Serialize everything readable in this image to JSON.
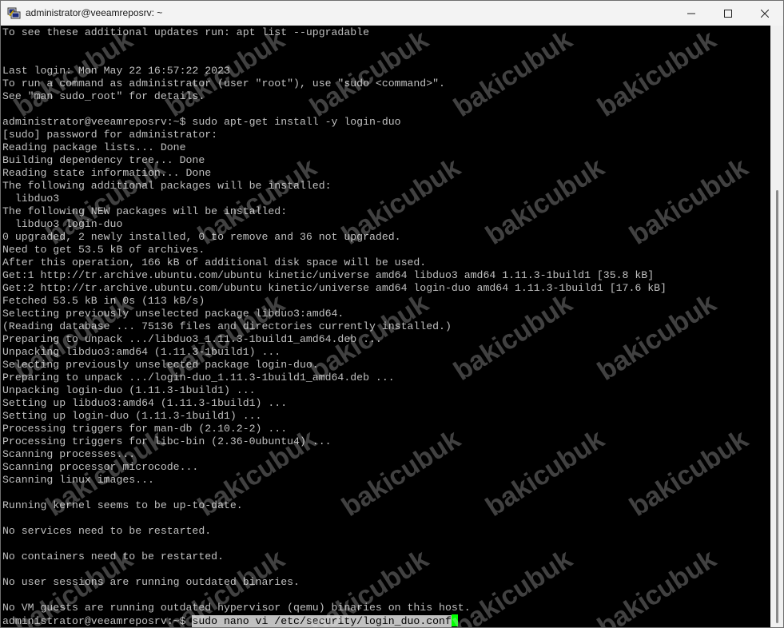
{
  "window": {
    "title": "administrator@veeamreposrv: ~",
    "icon": "putty-icon",
    "controls": {
      "minimize": "minimize-icon",
      "maximize": "maximize-icon",
      "close": "close-icon"
    }
  },
  "terminal": {
    "lines": [
      "To see these additional updates run: apt list --upgradable",
      "",
      "",
      "Last login: Mon May 22 16:57:22 2023",
      "To run a command as administrator (user \"root\"), use \"sudo <command>\".",
      "See \"man sudo_root\" for details.",
      "",
      "administrator@veeamreposrv:~$ sudo apt-get install -y login-duo",
      "[sudo] password for administrator:",
      "Reading package lists... Done",
      "Building dependency tree... Done",
      "Reading state information... Done",
      "The following additional packages will be installed:",
      "  libduo3",
      "The following NEW packages will be installed:",
      "  libduo3 login-duo",
      "0 upgraded, 2 newly installed, 0 to remove and 36 not upgraded.",
      "Need to get 53.5 kB of archives.",
      "After this operation, 166 kB of additional disk space will be used.",
      "Get:1 http://tr.archive.ubuntu.com/ubuntu kinetic/universe amd64 libduo3 amd64 1.11.3-1build1 [35.8 kB]",
      "Get:2 http://tr.archive.ubuntu.com/ubuntu kinetic/universe amd64 login-duo amd64 1.11.3-1build1 [17.6 kB]",
      "Fetched 53.5 kB in 0s (113 kB/s)",
      "Selecting previously unselected package libduo3:amd64.",
      "(Reading database ... 75136 files and directories currently installed.)",
      "Preparing to unpack .../libduo3_1.11.3-1build1_amd64.deb ...",
      "Unpacking libduo3:amd64 (1.11.3-1build1) ...",
      "Selecting previously unselected package login-duo.",
      "Preparing to unpack .../login-duo_1.11.3-1build1_amd64.deb ...",
      "Unpacking login-duo (1.11.3-1build1) ...",
      "Setting up libduo3:amd64 (1.11.3-1build1) ...",
      "Setting up login-duo (1.11.3-1build1) ...",
      "Processing triggers for man-db (2.10.2-2) ...",
      "Processing triggers for libc-bin (2.36-0ubuntu4) ...",
      "Scanning processes...",
      "Scanning processor microcode...",
      "Scanning linux images...",
      "",
      "Running kernel seems to be up-to-date.",
      "",
      "No services need to be restarted.",
      "",
      "No containers need to be restarted.",
      "",
      "No user sessions are running outdated binaries.",
      "",
      "No VM guests are running outdated hypervisor (qemu) binaries on this host."
    ],
    "prompt": "administrator@veeamreposrv:~$ ",
    "current_command": "sudo nano vi /etc/security/login_duo.conf",
    "cursor_color": "#00ff00"
  },
  "watermark": "bakicubuk"
}
